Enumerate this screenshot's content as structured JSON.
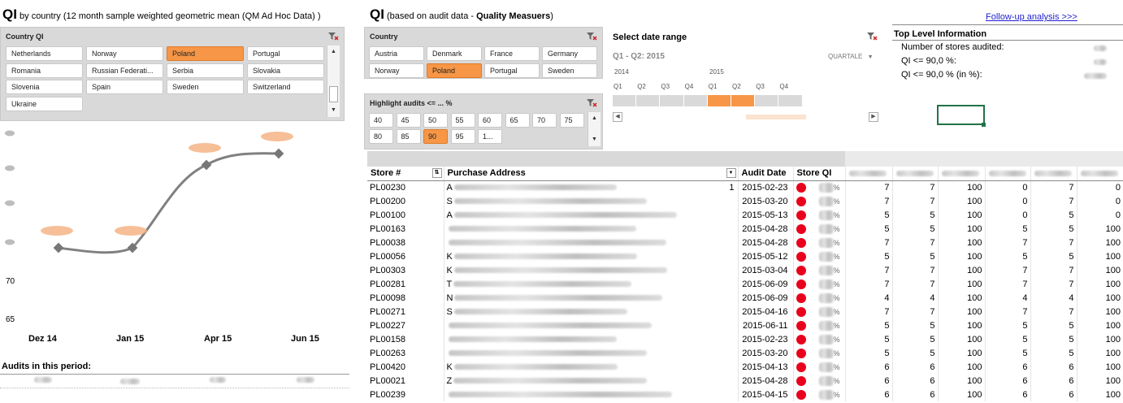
{
  "left": {
    "title_main": "QI",
    "title_rest": "by country (12 month sample weighted geometric mean (QM Ad Hoc Data) )",
    "slicer_title": "Country QI",
    "countries": [
      {
        "label": "Netherlands",
        "selected": false
      },
      {
        "label": "Norway",
        "selected": false
      },
      {
        "label": "Poland",
        "selected": true
      },
      {
        "label": "Portugal",
        "selected": false
      },
      {
        "label": "Romania",
        "selected": false
      },
      {
        "label": "Russian Federati...",
        "selected": false
      },
      {
        "label": "Serbia",
        "selected": false
      },
      {
        "label": "Slovakia",
        "selected": false
      },
      {
        "label": "Slovenia",
        "selected": false
      },
      {
        "label": "Spain",
        "selected": false
      },
      {
        "label": "Sweden",
        "selected": false
      },
      {
        "label": "Switzerland",
        "selected": false
      },
      {
        "label": "Ukraine",
        "selected": false
      }
    ],
    "y_labels": [
      "70",
      "65"
    ],
    "x_labels": [
      "Dez 14",
      "Jan 15",
      "Apr 15",
      "Jun 15"
    ],
    "audits_label": "Audits in this period:"
  },
  "right": {
    "title_main": "QI",
    "title_pre": "(based on audit data - ",
    "title_bold": "Quality Measuers",
    "title_post": ")",
    "followup_link": "Follow-up analysis >>>",
    "country_slicer_title": "Country",
    "countries": [
      {
        "label": "Austria",
        "selected": false
      },
      {
        "label": "Denmark",
        "selected": false
      },
      {
        "label": "France",
        "selected": false
      },
      {
        "label": "Germany",
        "selected": false
      },
      {
        "label": "Norway",
        "selected": false
      },
      {
        "label": "Poland",
        "selected": true
      },
      {
        "label": "Portugal",
        "selected": false
      },
      {
        "label": "Sweden",
        "selected": false
      }
    ],
    "highlight_title": "Highlight audits <= ... %",
    "highlight_values": [
      {
        "label": "40",
        "selected": false
      },
      {
        "label": "45",
        "selected": false
      },
      {
        "label": "50",
        "selected": false
      },
      {
        "label": "55",
        "selected": false
      },
      {
        "label": "60",
        "selected": false
      },
      {
        "label": "65",
        "selected": false
      },
      {
        "label": "70",
        "selected": false
      },
      {
        "label": "75",
        "selected": false
      },
      {
        "label": "80",
        "selected": false
      },
      {
        "label": "85",
        "selected": false
      },
      {
        "label": "90",
        "selected": true
      },
      {
        "label": "95",
        "selected": false
      },
      {
        "label": "1...",
        "selected": false
      }
    ],
    "date_range_title": "Select date range",
    "date_range_value": "Q1 - Q2: 2015",
    "period_level": "QUARTALE",
    "years": [
      "2014",
      "2015"
    ],
    "quarters": [
      "Q1",
      "Q2",
      "Q3",
      "Q4",
      "Q1",
      "Q2",
      "Q3",
      "Q4"
    ],
    "selected_quarters": [
      4,
      5
    ],
    "top_level_title": "Top Level Information",
    "top_level_items": [
      "Number of stores audited:",
      "QI <= 90,0 %:",
      "QI <= 90,0 % (in %):"
    ]
  },
  "table": {
    "headers": {
      "store": "Store #",
      "address": "Purchase Address",
      "audit_date": "Audit Date",
      "store_qi": "Store QI"
    },
    "rows": [
      {
        "store": "PL00230",
        "addr_initial": "A",
        "addr_tail": "1",
        "date": "2015-02-23",
        "pct": "%",
        "c1": "7",
        "c2": "7",
        "c3": "100",
        "c4": "0",
        "c5": "7",
        "c6": "0"
      },
      {
        "store": "PL00200",
        "addr_initial": "S",
        "addr_tail": "",
        "date": "2015-03-20",
        "pct": "%",
        "c1": "7",
        "c2": "7",
        "c3": "100",
        "c4": "0",
        "c5": "7",
        "c6": "0"
      },
      {
        "store": "PL00100",
        "addr_initial": "A",
        "addr_tail": "",
        "date": "2015-05-13",
        "pct": "%",
        "c1": "5",
        "c2": "5",
        "c3": "100",
        "c4": "0",
        "c5": "5",
        "c6": "0"
      },
      {
        "store": "PL00163",
        "addr_initial": "",
        "addr_tail": "",
        "date": "2015-04-28",
        "pct": "%",
        "c1": "5",
        "c2": "5",
        "c3": "100",
        "c4": "5",
        "c5": "5",
        "c6": "100"
      },
      {
        "store": "PL00038",
        "addr_initial": "",
        "addr_tail": "",
        "date": "2015-04-28",
        "pct": "%",
        "c1": "7",
        "c2": "7",
        "c3": "100",
        "c4": "7",
        "c5": "7",
        "c6": "100"
      },
      {
        "store": "PL00056",
        "addr_initial": "K",
        "addr_tail": "",
        "date": "2015-05-12",
        "pct": "%",
        "c1": "5",
        "c2": "5",
        "c3": "100",
        "c4": "5",
        "c5": "5",
        "c6": "100"
      },
      {
        "store": "PL00303",
        "addr_initial": "K",
        "addr_tail": "",
        "date": "2015-03-04",
        "pct": "%",
        "c1": "7",
        "c2": "7",
        "c3": "100",
        "c4": "7",
        "c5": "7",
        "c6": "100"
      },
      {
        "store": "PL00281",
        "addr_initial": "T",
        "addr_tail": "",
        "date": "2015-06-09",
        "pct": "%",
        "c1": "7",
        "c2": "7",
        "c3": "100",
        "c4": "7",
        "c5": "7",
        "c6": "100"
      },
      {
        "store": "PL00098",
        "addr_initial": "N",
        "addr_tail": "",
        "date": "2015-06-09",
        "pct": "%",
        "c1": "4",
        "c2": "4",
        "c3": "100",
        "c4": "4",
        "c5": "4",
        "c6": "100"
      },
      {
        "store": "PL00271",
        "addr_initial": "S",
        "addr_tail": "",
        "date": "2015-04-16",
        "pct": "%",
        "c1": "7",
        "c2": "7",
        "c3": "100",
        "c4": "7",
        "c5": "7",
        "c6": "100"
      },
      {
        "store": "PL00227",
        "addr_initial": "",
        "addr_tail": "",
        "date": "2015-06-11",
        "pct": "%",
        "c1": "5",
        "c2": "5",
        "c3": "100",
        "c4": "5",
        "c5": "5",
        "c6": "100"
      },
      {
        "store": "PL00158",
        "addr_initial": "",
        "addr_tail": "",
        "date": "2015-02-23",
        "pct": "%",
        "c1": "5",
        "c2": "5",
        "c3": "100",
        "c4": "5",
        "c5": "5",
        "c6": "100"
      },
      {
        "store": "PL00263",
        "addr_initial": "",
        "addr_tail": "",
        "date": "2015-03-20",
        "pct": "%",
        "c1": "5",
        "c2": "5",
        "c3": "100",
        "c4": "5",
        "c5": "5",
        "c6": "100"
      },
      {
        "store": "PL00420",
        "addr_initial": "K",
        "addr_tail": "",
        "date": "2015-04-13",
        "pct": "%",
        "c1": "6",
        "c2": "6",
        "c3": "100",
        "c4": "6",
        "c5": "6",
        "c6": "100"
      },
      {
        "store": "PL00021",
        "addr_initial": "Z",
        "addr_tail": "",
        "date": "2015-04-28",
        "pct": "%",
        "c1": "6",
        "c2": "6",
        "c3": "100",
        "c4": "6",
        "c5": "6",
        "c6": "100"
      },
      {
        "store": "PL00239",
        "addr_initial": "",
        "addr_tail": "",
        "date": "2015-04-15",
        "pct": "%",
        "c1": "6",
        "c2": "6",
        "c3": "100",
        "c4": "6",
        "c5": "6",
        "c6": "100"
      }
    ]
  },
  "colors": {
    "selected": "#f79646",
    "status_red": "#e8001c",
    "link": "#1f1fcf",
    "line": "#808080"
  }
}
